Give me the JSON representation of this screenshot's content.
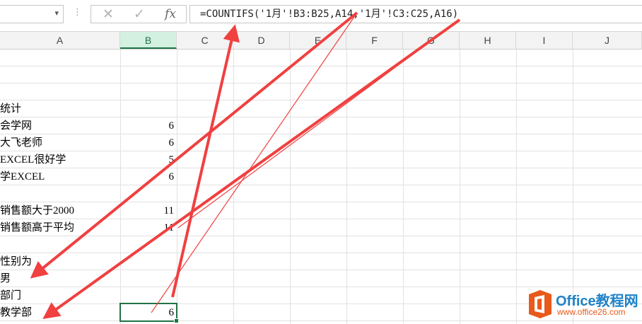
{
  "namebox": {
    "value": "",
    "dropdown": "▾"
  },
  "formula_bar": {
    "menu_icon": "⋮",
    "cancel_icon": "✕",
    "confirm_icon": "✓",
    "fx_label": "fx",
    "formula": "=COUNTIFS('1月'!B3:B25,A14,'1月'!C3:C25,A16)"
  },
  "columns": [
    "A",
    "B",
    "C",
    "D",
    "E",
    "F",
    "G",
    "H",
    "I",
    "J"
  ],
  "selected_column": "B",
  "cells": {
    "r4a": "统计",
    "r5a": "会学网",
    "r5b": "6",
    "r6a": "大飞老师",
    "r6b": "6",
    "r7a": "EXCEL很好学",
    "r7b": "5",
    "r8a": "学EXCEL",
    "r8b": "6",
    "r10a": "销售额大于2000",
    "r10b": "11",
    "r11a": "销售额高于平均",
    "r11b": "11",
    "r13a": "性别为",
    "r14a": "男",
    "r15a": "部门",
    "r16a": "教学部",
    "r16b": "6"
  },
  "colors": {
    "accent": "#217346",
    "annotation": "#f04040",
    "logo_blue": "#1f82c8",
    "logo_orange": "#e8591a"
  },
  "logo": {
    "title": "Office教程网",
    "subtitle": "www.office26.com"
  }
}
